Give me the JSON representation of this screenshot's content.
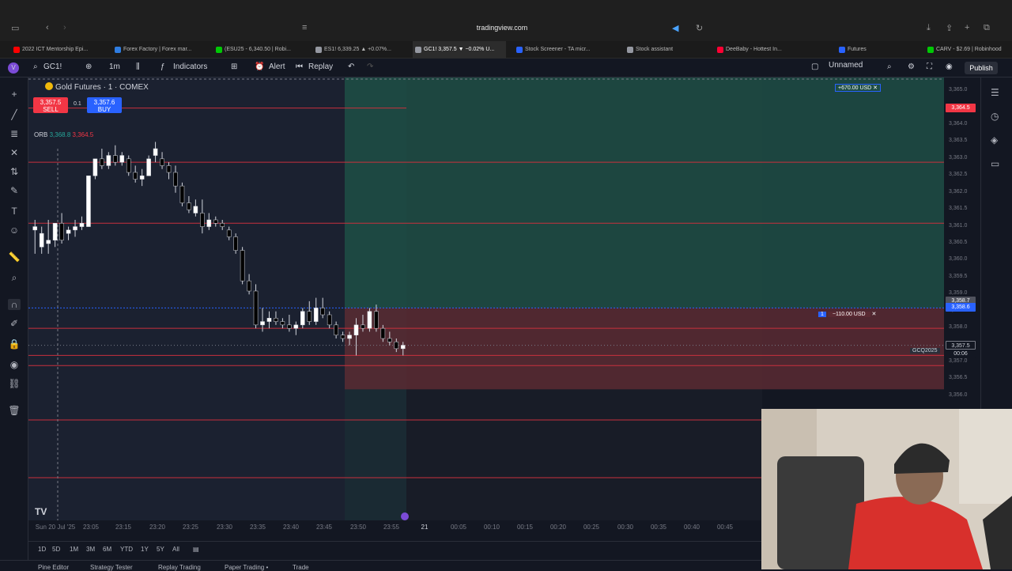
{
  "browser": {
    "url": "tradingview.com",
    "tabs": [
      {
        "label": "2022 ICT Mentorship Epi...",
        "color": "#ff0000"
      },
      {
        "label": "Forex Factory | Forex mar...",
        "color": "#2f7de1"
      },
      {
        "label": "(ESU25 - 6,340.50 | Robi...",
        "color": "#00c805"
      },
      {
        "label": "ES1! 6,339.25 ▲ +0.07%...",
        "color": "#9598a1"
      },
      {
        "label": "GC1! 3,357.5 ▼ −0.02% U...",
        "color": "#9598a1"
      },
      {
        "label": "Stock Screener - TA micr...",
        "color": "#2962ff"
      },
      {
        "label": "Stock assistant",
        "color": "#9598a1"
      },
      {
        "label": "DeeBaby - Hottest In...",
        "color": "#ff0033"
      },
      {
        "label": "Futures",
        "color": "#2962ff"
      },
      {
        "label": "CARV - $2.69 | Robinhood",
        "color": "#00c805"
      }
    ]
  },
  "toolbar": {
    "symbol": "GC1!",
    "interval": "1m",
    "indicators_label": "Indicators",
    "alert_label": "Alert",
    "replay_label": "Replay",
    "layout_name": "Unnamed",
    "publish_label": "Publish"
  },
  "legend": {
    "title": "Gold Futures · 1 · COMEX",
    "sell_price": "3,357.5",
    "sell_label": "SELL",
    "buy_price": "3,357.6",
    "buy_label": "BUY",
    "qty": "0.1",
    "orb_label": "ORB",
    "orb_high": "3,368.8",
    "orb_low": "3,364.5"
  },
  "price_axis": {
    "labels": [
      "3,365.0",
      "3,364.5",
      "3,364.0",
      "3,363.5",
      "3,363.0",
      "3,362.5",
      "3,362.0",
      "3,361.5",
      "3,361.0",
      "3,360.5",
      "3,360.0",
      "3,359.5",
      "3,359.0",
      "3,358.5",
      "3,358.0",
      "3,357.5",
      "3,357.0",
      "3,356.5",
      "3,356.0"
    ],
    "tag_red": "3,364.5",
    "tag_blue": "3,358.6",
    "tag_last": "3,357.5",
    "tag_last_time": "00:06",
    "tag_gray": "3,358.7",
    "contract": "GCQ2025"
  },
  "positions": {
    "profit_text": "+670.00 USD",
    "loss_text": "−110.00 USD",
    "qty": "1"
  },
  "time_axis": {
    "labels": [
      "Sun 20 Jul '25",
      "23:05",
      "23:15",
      "23:20",
      "23:25",
      "23:30",
      "23:35",
      "23:40",
      "23:45",
      "23:50",
      "23:55",
      "21",
      "00:05",
      "00:10",
      "00:15",
      "00:20",
      "00:25",
      "00:30",
      "00:35",
      "00:40",
      "00:45"
    ]
  },
  "bottom_ranges": [
    "1D",
    "5D",
    "1M",
    "3M",
    "6M",
    "YTD",
    "1Y",
    "5Y",
    "All"
  ],
  "bottom_panels": [
    "Pine Editor",
    "Strategy Tester",
    "Replay Trading",
    "Paper Trading •",
    "Trade"
  ],
  "colors": {
    "bg": "#131722",
    "profit_zone": "#1e4d45",
    "loss_zone": "#5a2a33",
    "bull": "#ffffff",
    "bear": "#000000",
    "red_line": "#c8303d",
    "blue_line": "#2962ff"
  },
  "chart_data": {
    "type": "candlestick",
    "candles": [
      {
        "o": 3360.9,
        "h": 3361.2,
        "l": 3360.2,
        "c": 3361.0
      },
      {
        "o": 3360.4,
        "h": 3361.0,
        "l": 3360.2,
        "c": 3360.8
      },
      {
        "o": 3360.5,
        "h": 3361.2,
        "l": 3360.2,
        "c": 3360.6
      },
      {
        "o": 3360.6,
        "h": 3361.1,
        "l": 3360.4,
        "c": 3361.1
      },
      {
        "o": 3361.1,
        "h": 3361.4,
        "l": 3360.5,
        "c": 3360.6
      },
      {
        "o": 3360.8,
        "h": 3361.0,
        "l": 3360.6,
        "c": 3360.9
      },
      {
        "o": 3360.9,
        "h": 3361.2,
        "l": 3360.7,
        "c": 3361.0
      },
      {
        "o": 3361.0,
        "h": 3361.3,
        "l": 3360.9,
        "c": 3361.1
      },
      {
        "o": 3361.0,
        "h": 3362.5,
        "l": 3361.0,
        "c": 3362.5
      },
      {
        "o": 3362.5,
        "h": 3363.0,
        "l": 3362.4,
        "c": 3363.0
      },
      {
        "o": 3363.0,
        "h": 3363.3,
        "l": 3362.7,
        "c": 3362.8
      },
      {
        "o": 3362.8,
        "h": 3363.2,
        "l": 3362.7,
        "c": 3363.1
      },
      {
        "o": 3363.1,
        "h": 3363.4,
        "l": 3362.8,
        "c": 3362.9
      },
      {
        "o": 3362.9,
        "h": 3363.2,
        "l": 3362.8,
        "c": 3363.1
      },
      {
        "o": 3363.0,
        "h": 3363.1,
        "l": 3362.5,
        "c": 3362.6
      },
      {
        "o": 3362.6,
        "h": 3362.8,
        "l": 3362.3,
        "c": 3362.4
      },
      {
        "o": 3362.4,
        "h": 3362.7,
        "l": 3362.2,
        "c": 3362.5
      },
      {
        "o": 3362.5,
        "h": 3363.1,
        "l": 3362.5,
        "c": 3363.0
      },
      {
        "o": 3363.1,
        "h": 3363.5,
        "l": 3362.9,
        "c": 3363.3
      },
      {
        "o": 3363.0,
        "h": 3363.2,
        "l": 3362.7,
        "c": 3362.8
      },
      {
        "o": 3362.8,
        "h": 3362.9,
        "l": 3362.4,
        "c": 3362.6
      },
      {
        "o": 3362.6,
        "h": 3362.8,
        "l": 3362.0,
        "c": 3362.2
      },
      {
        "o": 3362.2,
        "h": 3362.3,
        "l": 3361.6,
        "c": 3361.7
      },
      {
        "o": 3361.7,
        "h": 3361.9,
        "l": 3361.4,
        "c": 3361.5
      },
      {
        "o": 3361.4,
        "h": 3361.8,
        "l": 3361.3,
        "c": 3361.6
      },
      {
        "o": 3361.4,
        "h": 3361.8,
        "l": 3360.8,
        "c": 3361.0
      },
      {
        "o": 3361.0,
        "h": 3361.4,
        "l": 3360.9,
        "c": 3361.2
      },
      {
        "o": 3361.2,
        "h": 3361.3,
        "l": 3361.0,
        "c": 3361.1
      },
      {
        "o": 3361.1,
        "h": 3361.2,
        "l": 3360.9,
        "c": 3361.0
      },
      {
        "o": 3360.9,
        "h": 3361.0,
        "l": 3360.6,
        "c": 3360.7
      },
      {
        "o": 3360.7,
        "h": 3360.8,
        "l": 3360.2,
        "c": 3360.3
      },
      {
        "o": 3360.3,
        "h": 3360.4,
        "l": 3359.3,
        "c": 3359.4
      },
      {
        "o": 3359.4,
        "h": 3359.6,
        "l": 3359.0,
        "c": 3359.1
      },
      {
        "o": 3359.1,
        "h": 3359.3,
        "l": 3358.0,
        "c": 3358.1
      },
      {
        "o": 3358.1,
        "h": 3358.6,
        "l": 3357.9,
        "c": 3358.2
      },
      {
        "o": 3358.2,
        "h": 3358.5,
        "l": 3358.0,
        "c": 3358.3
      },
      {
        "o": 3358.3,
        "h": 3358.5,
        "l": 3358.1,
        "c": 3358.2
      },
      {
        "o": 3358.2,
        "h": 3358.3,
        "l": 3358.0,
        "c": 3358.1
      },
      {
        "o": 3358.1,
        "h": 3358.4,
        "l": 3357.9,
        "c": 3358.0
      },
      {
        "o": 3358.0,
        "h": 3358.2,
        "l": 3357.8,
        "c": 3358.1
      },
      {
        "o": 3358.1,
        "h": 3358.6,
        "l": 3358.0,
        "c": 3358.5
      },
      {
        "o": 3358.5,
        "h": 3358.8,
        "l": 3358.1,
        "c": 3358.2
      },
      {
        "o": 3358.2,
        "h": 3358.9,
        "l": 3358.1,
        "c": 3358.6
      },
      {
        "o": 3358.6,
        "h": 3358.9,
        "l": 3358.3,
        "c": 3358.4
      },
      {
        "o": 3358.4,
        "h": 3358.5,
        "l": 3358.0,
        "c": 3358.1
      },
      {
        "o": 3358.1,
        "h": 3358.2,
        "l": 3357.7,
        "c": 3357.8
      },
      {
        "o": 3357.8,
        "h": 3357.9,
        "l": 3357.6,
        "c": 3357.7
      },
      {
        "o": 3357.7,
        "h": 3357.9,
        "l": 3357.5,
        "c": 3357.8
      },
      {
        "o": 3357.8,
        "h": 3358.3,
        "l": 3357.2,
        "c": 3358.1
      },
      {
        "o": 3358.1,
        "h": 3358.4,
        "l": 3357.9,
        "c": 3358.0
      },
      {
        "o": 3358.0,
        "h": 3358.6,
        "l": 3357.9,
        "c": 3358.5
      },
      {
        "o": 3358.5,
        "h": 3358.7,
        "l": 3357.9,
        "c": 3358.0
      },
      {
        "o": 3358.0,
        "h": 3358.1,
        "l": 3357.6,
        "c": 3357.7
      },
      {
        "o": 3357.7,
        "h": 3357.9,
        "l": 3357.5,
        "c": 3357.6
      },
      {
        "o": 3357.6,
        "h": 3357.7,
        "l": 3357.3,
        "c": 3357.4
      },
      {
        "o": 3357.4,
        "h": 3357.6,
        "l": 3357.2,
        "c": 3357.5
      }
    ],
    "ylim": [
      3355.6,
      3365.4
    ],
    "horizontal_lines": [
      3364.5,
      3362.9,
      3361.1,
      3358.0,
      3357.2,
      3356.9
    ],
    "profit_zone": [
      3358.6,
      3365.4
    ],
    "loss_zone": [
      3356.2,
      3358.6
    ]
  }
}
